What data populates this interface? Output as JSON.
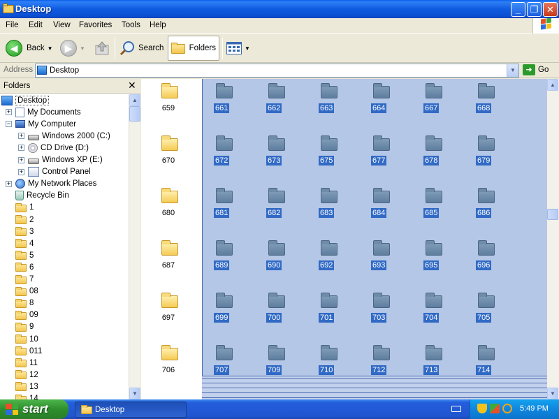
{
  "window": {
    "title": "Desktop"
  },
  "menu": [
    "File",
    "Edit",
    "View",
    "Favorites",
    "Tools",
    "Help"
  ],
  "toolbar": {
    "back_label": "Back",
    "search_label": "Search",
    "folders_label": "Folders"
  },
  "address": {
    "label": "Address",
    "value": "Desktop",
    "go_label": "Go"
  },
  "folders_pane": {
    "title": "Folders",
    "close_glyph": "✕",
    "tree": [
      {
        "label": "Desktop",
        "icon": "desktop-icon",
        "level": 0,
        "expander": "",
        "selected": true
      },
      {
        "label": "My Documents",
        "icon": "documents-icon",
        "level": 1,
        "expander": "+"
      },
      {
        "label": "My Computer",
        "icon": "computer-icon",
        "level": 1,
        "expander": "−"
      },
      {
        "label": "Windows 2000 (C:)",
        "icon": "drive-icon",
        "level": 2,
        "expander": "+"
      },
      {
        "label": "CD Drive (D:)",
        "icon": "cd-drive-icon",
        "level": 2,
        "expander": "+"
      },
      {
        "label": "Windows XP (E:)",
        "icon": "drive-icon",
        "level": 2,
        "expander": "+"
      },
      {
        "label": "Control Panel",
        "icon": "control-panel-icon",
        "level": 2,
        "expander": "+"
      },
      {
        "label": "My Network Places",
        "icon": "network-icon",
        "level": 1,
        "expander": "+"
      },
      {
        "label": "Recycle Bin",
        "icon": "recycle-bin-icon",
        "level": 1,
        "expander": ""
      },
      {
        "label": "1",
        "icon": "folder-icon",
        "level": 1,
        "expander": ""
      },
      {
        "label": "2",
        "icon": "folder-icon",
        "level": 1,
        "expander": ""
      },
      {
        "label": "3",
        "icon": "folder-icon",
        "level": 1,
        "expander": ""
      },
      {
        "label": "4",
        "icon": "folder-icon",
        "level": 1,
        "expander": ""
      },
      {
        "label": "5",
        "icon": "folder-icon",
        "level": 1,
        "expander": ""
      },
      {
        "label": "6",
        "icon": "folder-icon",
        "level": 1,
        "expander": ""
      },
      {
        "label": "7",
        "icon": "folder-icon",
        "level": 1,
        "expander": ""
      },
      {
        "label": "08",
        "icon": "folder-icon",
        "level": 1,
        "expander": ""
      },
      {
        "label": "8",
        "icon": "folder-icon",
        "level": 1,
        "expander": ""
      },
      {
        "label": "09",
        "icon": "folder-icon",
        "level": 1,
        "expander": ""
      },
      {
        "label": "9",
        "icon": "folder-icon",
        "level": 1,
        "expander": ""
      },
      {
        "label": "10",
        "icon": "folder-icon",
        "level": 1,
        "expander": ""
      },
      {
        "label": "011",
        "icon": "folder-icon",
        "level": 1,
        "expander": ""
      },
      {
        "label": "11",
        "icon": "folder-icon",
        "level": 1,
        "expander": ""
      },
      {
        "label": "12",
        "icon": "folder-icon",
        "level": 1,
        "expander": ""
      },
      {
        "label": "13",
        "icon": "folder-icon",
        "level": 1,
        "expander": ""
      },
      {
        "label": "14",
        "icon": "folder-icon",
        "level": 1,
        "expander": ""
      }
    ]
  },
  "files": {
    "rows": [
      {
        "first": "659",
        "selected": [
          "661",
          "662",
          "663",
          "664",
          "667",
          "668"
        ]
      },
      {
        "first": "670",
        "selected": [
          "672",
          "673",
          "675",
          "677",
          "678",
          "679"
        ]
      },
      {
        "first": "680",
        "selected": [
          "681",
          "682",
          "683",
          "684",
          "685",
          "686"
        ]
      },
      {
        "first": "687",
        "selected": [
          "689",
          "690",
          "692",
          "693",
          "695",
          "696"
        ]
      },
      {
        "first": "697",
        "selected": [
          "699",
          "700",
          "701",
          "703",
          "704",
          "705"
        ]
      },
      {
        "first": "706",
        "selected": [
          "707",
          "709",
          "710",
          "712",
          "713",
          "714"
        ]
      }
    ]
  },
  "taskbar": {
    "start_label": "start",
    "task_label": "Desktop",
    "clock": "5:49 PM"
  },
  "colors": {
    "selection_fill": "#B5C7E6",
    "selection_label": "#316AC5",
    "titlebar": "#0A4FD2",
    "start_green": "#2E8E2C",
    "tray_blue": "#0F86DE"
  }
}
